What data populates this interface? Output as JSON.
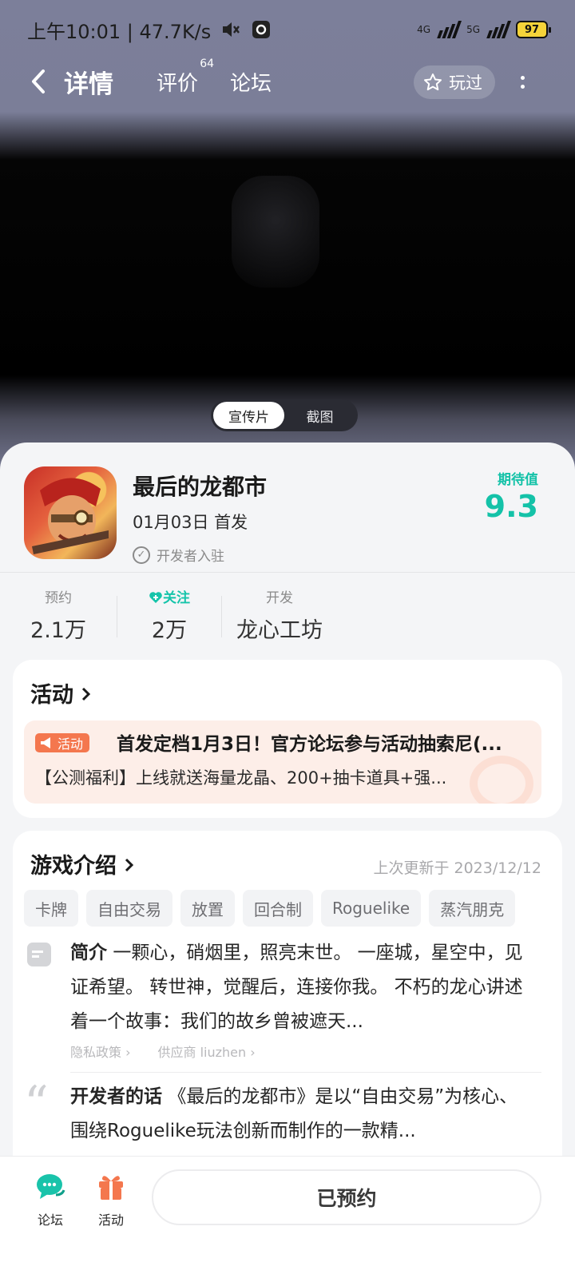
{
  "status_bar": {
    "time_speed": "上午10:01 | 47.7K/s",
    "network_1": "4G",
    "network_2": "5G",
    "battery": "97"
  },
  "nav": {
    "tabs": [
      {
        "label": "详情",
        "active": true
      },
      {
        "label": "评价",
        "badge": "64"
      },
      {
        "label": "论坛"
      }
    ],
    "played_label": "玩过"
  },
  "media_toggle": {
    "options": [
      "宣传片",
      "截图"
    ],
    "selected": "宣传片"
  },
  "game": {
    "name": "最后的龙都市",
    "release": "01月03日 首发",
    "developer_badge": "开发者入驻",
    "expect_label": "期待值",
    "expect_value": "9.3"
  },
  "stats": [
    {
      "label": "预约",
      "value": "2.1万"
    },
    {
      "label": "关注",
      "value": "2万"
    },
    {
      "label": "开发",
      "value": "龙心工坊"
    }
  ],
  "activity": {
    "title": "活动",
    "tag": "活动",
    "headline": "首发定档1月3日！官方论坛参与活动抽索尼(...",
    "subline": "【公测福利】上线就送海量龙晶、200+抽卡道具+强..."
  },
  "intro": {
    "title": "游戏介绍",
    "updated": "上次更新于 2023/12/12",
    "tags": [
      "卡牌",
      "自由交易",
      "放置",
      "回合制",
      "Roguelike",
      "蒸汽朋克"
    ],
    "summary_label": "简介",
    "summary": "一颗心，硝烟里，照亮末世。 一座城，星空中，见证希望。 转世神，觉醒后，连接你我。 不朽的龙心讲述着一个故事：我们的故乡曾被遮天...",
    "privacy": "隐私政策",
    "supplier": "供应商 liuzhen",
    "dev_words_label": "开发者的话",
    "dev_words": "《最后的龙都市》是以“自由交易”为核心、围绕Roguelike玩法创新而制作的一款精..."
  },
  "bottom": {
    "forum": "论坛",
    "activity": "活动",
    "reserve": "已预约"
  },
  "colors": {
    "accent": "#14c2a8",
    "activity_orange": "#f4774e"
  }
}
